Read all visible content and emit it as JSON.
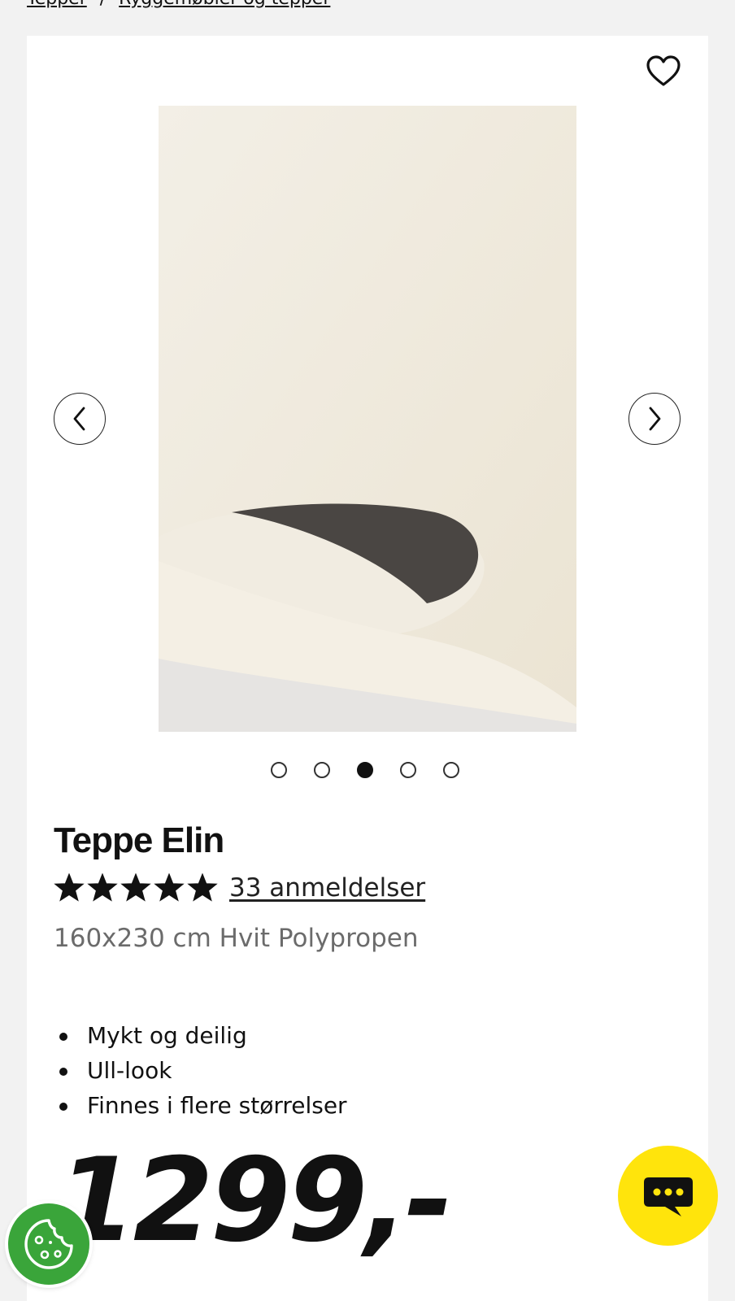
{
  "breadcrumb": {
    "items": [
      "Tepper",
      "Ryggemøbler og tepper"
    ],
    "separator": "/"
  },
  "product": {
    "title": "Teppe Elin",
    "rating": {
      "stars": 5,
      "max": 5,
      "reviews_label": "33 anmeldelser"
    },
    "variant": "160x230 cm Hvit Polypropen",
    "features": [
      "Mykt og deilig",
      "Ull-look",
      "Finnes i flere størrelser"
    ],
    "price": "1299,-"
  },
  "gallery": {
    "slide_count": 5,
    "active_slide": 3
  },
  "colors": {
    "chat_button": "#ffe40c",
    "cookie_button": "#3aa53a",
    "text": "#111111",
    "muted_text": "#6b6b6b"
  },
  "icons": {
    "favorite": "heart-icon",
    "prev": "chevron-left-icon",
    "next": "chevron-right-icon",
    "chat": "chat-bubble-icon",
    "cookie": "cookie-icon",
    "star": "star-icon"
  }
}
